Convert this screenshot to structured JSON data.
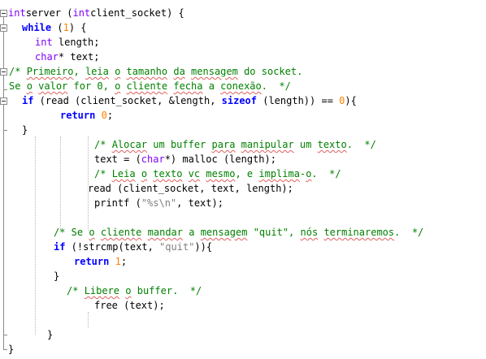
{
  "colors": {
    "keyword": "#0000ff",
    "type": "#8000ff",
    "number": "#ff8000",
    "string": "#808080",
    "comment": "#008000",
    "spellcheck": "#e06060",
    "fold_marker": "#8a8a8a"
  },
  "code_lines": [
    [
      [
        "ty",
        "int"
      ],
      [
        "",
        "server ("
      ],
      [
        "ty",
        "int"
      ],
      [
        "",
        "client_socket) {"
      ]
    ],
    [
      [
        "kw",
        "while"
      ],
      [
        "",
        " ("
      ],
      [
        "num",
        "1"
      ],
      [
        "",
        ") {"
      ]
    ],
    [
      [
        "ty",
        "int"
      ],
      [
        "",
        "",
        " length;"
      ]
    ],
    [
      [
        "ty",
        "char"
      ],
      [
        "",
        "* text;"
      ]
    ],
    [
      [
        "cm",
        "/* "
      ],
      [
        "cm sp",
        "Primeiro"
      ],
      [
        "cm",
        ", "
      ],
      [
        "cm sp",
        "leia"
      ],
      [
        "cm",
        " "
      ],
      [
        "cm sp",
        "o"
      ],
      [
        "cm",
        " "
      ],
      [
        "cm sp",
        "tamanho"
      ],
      [
        "cm",
        " "
      ],
      [
        "cm sp",
        "da"
      ],
      [
        "cm",
        " "
      ],
      [
        "cm sp",
        "mensagem"
      ],
      [
        "cm",
        " do socket."
      ]
    ],
    [
      [
        "cm",
        "Se "
      ],
      [
        "cm sp",
        "o"
      ],
      [
        "cm",
        " "
      ],
      [
        "cm sp",
        "valor"
      ],
      [
        "cm",
        " for 0, "
      ],
      [
        "cm sp",
        "o"
      ],
      [
        "cm",
        " "
      ],
      [
        "cm sp",
        "cliente"
      ],
      [
        "cm",
        " "
      ],
      [
        "cm sp",
        "fecha"
      ],
      [
        "cm",
        " a "
      ],
      [
        "cm sp",
        "conexão"
      ],
      [
        "cm",
        ".  */"
      ]
    ],
    [
      [
        "kw",
        "if"
      ],
      [
        "",
        " (read (client_socket, &length, "
      ],
      [
        "kw",
        "sizeof"
      ],
      [
        "",
        " (length)) == "
      ],
      [
        "num",
        "0"
      ],
      [
        "",
        ")"
      ],
      [
        "",
        "{"
      ]
    ],
    [
      [
        "kw",
        "return"
      ],
      [
        "",
        " "
      ],
      [
        "num",
        "0"
      ],
      [
        "",
        ";"
      ]
    ],
    [
      [
        "",
        "}"
      ]
    ],
    [
      [
        "cm",
        "/* "
      ],
      [
        "cm sp",
        "Alocar"
      ],
      [
        "cm",
        " um buffer "
      ],
      [
        "cm sp",
        "para"
      ],
      [
        "cm",
        " "
      ],
      [
        "cm sp",
        "manipular"
      ],
      [
        "cm",
        " um "
      ],
      [
        "cm sp",
        "texto"
      ],
      [
        "cm",
        ".  */"
      ]
    ],
    [
      [
        "",
        "text = ("
      ],
      [
        "ty",
        "char"
      ],
      [
        "",
        "*) malloc (length);"
      ]
    ],
    [
      [
        "cm",
        "/* "
      ],
      [
        "cm sp",
        "Leia"
      ],
      [
        "cm",
        " "
      ],
      [
        "cm sp",
        "o"
      ],
      [
        "cm",
        " "
      ],
      [
        "cm sp",
        "texto"
      ],
      [
        "cm",
        " "
      ],
      [
        "cm sp",
        "vc"
      ],
      [
        "cm",
        " "
      ],
      [
        "cm sp",
        "mesmo"
      ],
      [
        "cm",
        ", e "
      ],
      [
        "cm sp",
        "implima"
      ],
      [
        "cm",
        "-"
      ],
      [
        "cm sp",
        "o"
      ],
      [
        "cm",
        ".  */"
      ]
    ],
    [
      [
        "",
        "read (client_socket, text, length);"
      ]
    ],
    [
      [
        "",
        "printf ("
      ],
      [
        "str",
        "\"%s\\n\""
      ],
      [
        "",
        ", text);"
      ]
    ],
    [
      [
        "cm",
        "/* Se "
      ],
      [
        "cm sp",
        "o"
      ],
      [
        "cm",
        " "
      ],
      [
        "cm sp",
        "cliente"
      ],
      [
        "cm",
        " "
      ],
      [
        "cm sp",
        "mandar"
      ],
      [
        "cm",
        " a "
      ],
      [
        "cm sp",
        "mensagem"
      ],
      [
        "cm",
        " \"quit\", "
      ],
      [
        "cm sp",
        "nós"
      ],
      [
        "cm",
        " "
      ],
      [
        "cm sp",
        "terminaremos"
      ],
      [
        "cm",
        ".  */"
      ]
    ],
    [
      [
        "kw",
        "if"
      ],
      [
        "",
        " (!strcmp(text, "
      ],
      [
        "str",
        "\"quit\""
      ],
      [
        "",
        "))"
      ],
      [
        "",
        "{"
      ]
    ],
    [
      [
        "kw",
        "return"
      ],
      [
        "",
        " "
      ],
      [
        "num",
        "1"
      ],
      [
        "",
        ";"
      ]
    ],
    [
      [
        "",
        "}"
      ]
    ],
    [
      [
        "cm",
        "/* "
      ],
      [
        "cm sp",
        "Libere"
      ],
      [
        "cm",
        " "
      ],
      [
        "cm sp",
        "o"
      ],
      [
        "cm",
        " buffer.  */"
      ]
    ],
    [
      [
        "",
        "free (text);"
      ]
    ],
    [
      [
        "",
        "}"
      ]
    ],
    [
      [
        "",
        "}"
      ]
    ]
  ]
}
